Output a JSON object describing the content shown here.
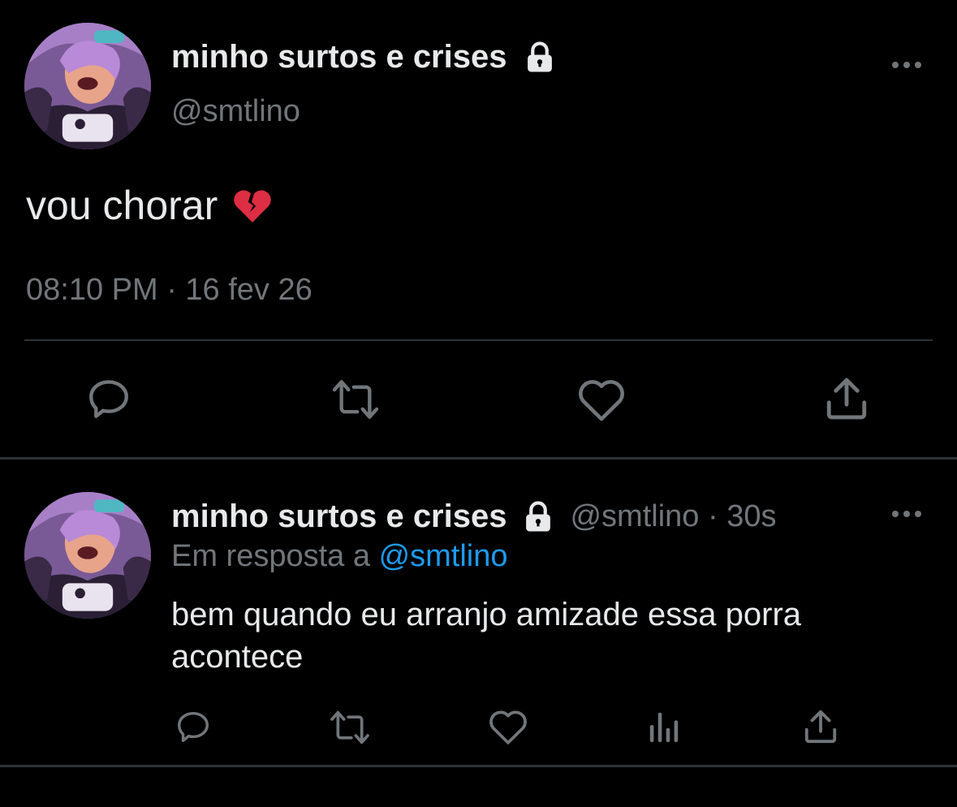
{
  "main_tweet": {
    "display_name": "minho surtos e crises",
    "handle": "@smtlino",
    "text": "vou chorar",
    "emoji": "broken-heart",
    "timestamp": "08:10 PM · 16 fev 26",
    "actions": [
      "reply-icon",
      "retweet-icon",
      "like-icon",
      "share-icon"
    ]
  },
  "reply_tweet": {
    "display_name": "minho surtos e crises",
    "handle_time": "@smtlino · 30s",
    "reply_prefix": "Em resposta a",
    "reply_mention": "@smtlino",
    "text": "bem quando eu arranjo amizade essa porra acontece",
    "actions": [
      "reply-icon",
      "retweet-icon",
      "like-icon",
      "analytics-icon",
      "share-icon"
    ]
  },
  "colors": {
    "background": "#000000",
    "text": "#e7e9ea",
    "muted": "#71767b",
    "link": "#1d9bf0",
    "divider": "#2f3336"
  }
}
